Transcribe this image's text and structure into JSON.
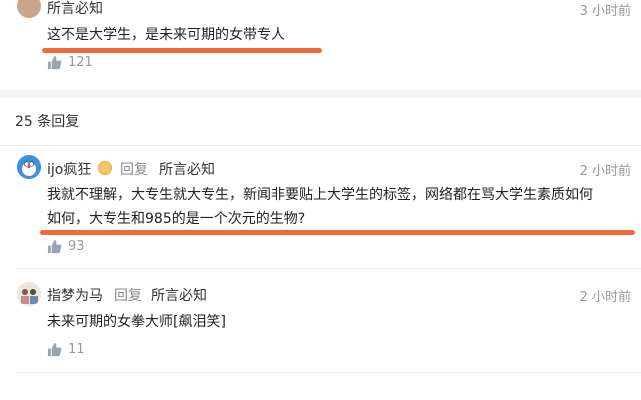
{
  "top_comment": {
    "author": "所言必知",
    "time": "3 小时前",
    "text": "这不是大学生，是未来可期的女带专人",
    "likes": "121"
  },
  "replies_header": "25 条回复",
  "replies": [
    {
      "author": "ijo疯狂",
      "reply_word": "回复",
      "reply_to": "所言必知",
      "time": "2 小时前",
      "text_line1": "我就不理解，大专生就大专生，新闻非要贴上大学生的标签，网络都在骂大学生素质如何",
      "text_line2": "如何，大专生和985的是一个次元的生物?",
      "likes": "93"
    },
    {
      "author": "指梦为马",
      "reply_word": "回复",
      "reply_to": "所言必知",
      "time": "2 小时前",
      "text": "未来可期的女拳大师[飙泪笑]",
      "likes": "11"
    }
  ],
  "colors": {
    "underline": "#f06a3c",
    "meta": "#999999"
  }
}
